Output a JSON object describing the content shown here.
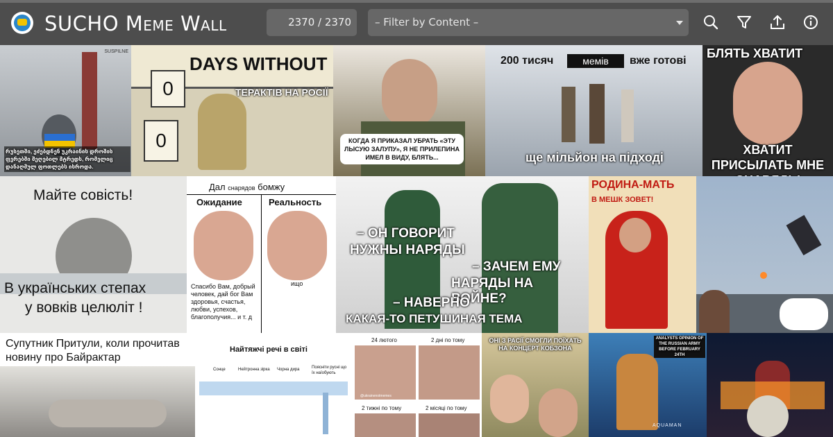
{
  "header": {
    "title": "SUCHO Meme Wall",
    "counter": "2370 / 2370",
    "filter_placeholder": "– Filter by Content –"
  },
  "colors": {
    "topbar": "#4d4d4d",
    "control_bg": "#676767"
  },
  "icons": [
    "search-icon",
    "filter-icon",
    "upload-icon",
    "info-icon"
  ],
  "memes": {
    "m1": {
      "watermark": "SUSPILNE",
      "caption": "რუსეთში, ეძებდნენ უკრაინის დროშის ფერებში შეღებილ მტრედს, რომელიც დანაღმულ ფოთლებს ისროდა."
    },
    "m2": {
      "heading": "DAYS WITHOUT",
      "sub": "ТЕРАКТІВ НА РОСІЇ",
      "digit1": "0",
      "digit2": "0"
    },
    "m3": {
      "caption": "КОГДА Я ПРИКАЗАЛ УБРАТЬ «ЭТУ ЛЫСУЮ ЗАЛУПУ», Я НЕ ПРИЛЕПИНА ИМЕЛ В ВИДУ, БЛЯТЬ..."
    },
    "m4": {
      "top_left": "200 тисяч",
      "top_box": "мемів",
      "top_right": "вже готові",
      "bottom": "ще мільйон на підході"
    },
    "m5": {
      "top": "БЛЯТЬ ХВАТИТ",
      "bottom": "ХВАТИТ ПРИСЫЛАТЬ МНЕ СНАРЯДЫ"
    },
    "m6": {
      "top": "Майте совість!",
      "bottom1": "В українських степах",
      "bottom2": "у вовків целюліт !"
    },
    "m7": {
      "title_big": "Дал",
      "title_small": "снарядов",
      "title_end": "бомжу",
      "col1": "Ожидание",
      "col2": "Реальность",
      "text1": "Спасибо Вам, добрый человек, дай бог Вам здоровья, счастья, любви, успехов, благополучия... и т. д",
      "text2": "ищо"
    },
    "m8": {
      "l1": "– ОН ГОВОРИТ",
      "l2": "НУЖНЫ НАРЯДЫ",
      "l3": "– ЗАЧЕМ ЕМУ",
      "l4": "НАРЯДЫ НА ВОЙНЕ?",
      "l5": "– НАВЕРНО",
      "l6": "КАКАЯ-ТО ПЕТУШИНАЯ ТЕМА"
    },
    "m9": {
      "top": "РОДИНА-МАТЬ",
      "sub": "В МЕШК ЗОВЕТ!"
    },
    "m11": {
      "caption": "Супутник Притули, коли прочитав новину про Байрактар"
    },
    "m12": {
      "title": "Найтяжчі речі в світі",
      "l1": "Сонце",
      "l2": "Нейтронна зірка",
      "l3": "Чорна дира",
      "l4": "Поясніти русні що їх наїобують"
    },
    "m13": {
      "q1": "24 лютого",
      "q2": "2 дні по тому",
      "q3": "2 тижні по тому",
      "q4": "2 місяці по тому",
      "watermark": "@ukrainenotmemes"
    },
    "m14": {
      "caption": "ОНІ З РАСІЇ СМОГЛИ ПОЇХАТЬ НА КОНЦЕРТ КОБЗОНА"
    },
    "m15": {
      "caption": "ANALYSTS OPINION OF THE RUSSIAN ARMY BEFORE FEBRUARY 24TH",
      "logo": "AQUAMAN"
    }
  }
}
